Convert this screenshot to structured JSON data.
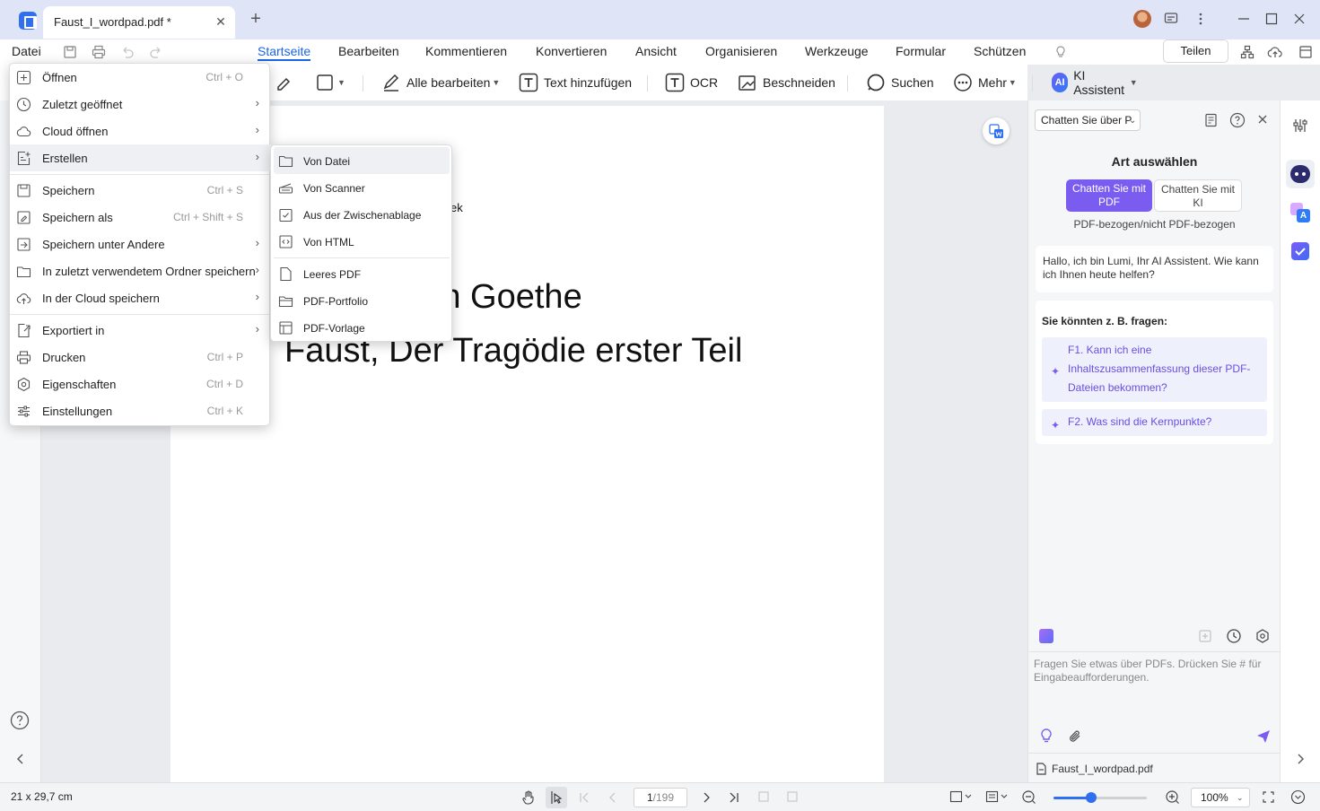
{
  "window": {
    "tab_title": "Faust_I_wordpad.pdf *",
    "close_tab": "✕",
    "new_tab": "+"
  },
  "menubar": {
    "file_label": "Datei",
    "tabs": [
      {
        "label": "Startseite",
        "active": true
      },
      {
        "label": "Bearbeiten"
      },
      {
        "label": "Kommentieren"
      },
      {
        "label": "Konvertieren"
      },
      {
        "label": "Ansicht"
      },
      {
        "label": "Organisieren"
      },
      {
        "label": "Werkzeuge"
      },
      {
        "label": "Formular"
      },
      {
        "label": "Schützen"
      }
    ],
    "share_label": "Teilen"
  },
  "toolbar": {
    "edit_all": "Alle bearbeiten",
    "add_text": "Text hinzufügen",
    "ocr": "OCR",
    "crop": "Beschneiden",
    "search": "Suchen",
    "more": "Mehr",
    "ai_badge": "AI",
    "ai_assistant": "KI Assistent"
  },
  "file_menu": {
    "items": [
      {
        "label": "Öffnen",
        "shortcut": "Ctrl + O",
        "icon": "plus-box-icon"
      },
      {
        "label": "Zuletzt geöffnet",
        "submenu": true,
        "icon": "clock-icon"
      },
      {
        "label": "Cloud öffnen",
        "submenu": true,
        "icon": "cloud-icon"
      },
      {
        "label": "Erstellen",
        "submenu": true,
        "highlighted": true,
        "icon": "create-icon"
      },
      {
        "label": "Speichern",
        "shortcut": "Ctrl + S",
        "icon": "save-icon"
      },
      {
        "label": "Speichern als",
        "shortcut": "Ctrl + Shift + S",
        "icon": "save-as-icon"
      },
      {
        "label": "Speichern unter Andere",
        "submenu": true,
        "icon": "save-other-icon"
      },
      {
        "label": "In zuletzt verwendetem Ordner speichern",
        "submenu": true,
        "icon": "folder-icon"
      },
      {
        "label": "In der Cloud speichern",
        "submenu": true,
        "icon": "cloud-upload-icon"
      },
      {
        "label": "Exportiert in",
        "submenu": true,
        "icon": "export-icon"
      },
      {
        "label": "Drucken",
        "shortcut": "Ctrl + P",
        "icon": "print-icon"
      },
      {
        "label": "Eigenschaften",
        "shortcut": "Ctrl + D",
        "icon": "properties-icon"
      },
      {
        "label": "Einstellungen",
        "shortcut": "Ctrl + K",
        "icon": "settings-sliders-icon"
      }
    ]
  },
  "create_submenu": {
    "items": [
      {
        "label": "Von Datei",
        "highlighted": true,
        "icon": "folder-icon"
      },
      {
        "label": "Von Scanner",
        "icon": "scanner-icon"
      },
      {
        "label": "Aus der Zwischenablage",
        "icon": "clipboard-icon"
      },
      {
        "label": "Von HTML",
        "icon": "html-icon"
      },
      {
        "label": "Leeres PDF",
        "icon": "blank-page-icon"
      },
      {
        "label": "PDF-Portfolio",
        "icon": "portfolio-icon"
      },
      {
        "label": "PDF-Vorlage",
        "icon": "template-icon"
      }
    ]
  },
  "document": {
    "fragment": "ek",
    "line1": "olfgang von Goethe",
    "line2": "Faust, Der Tragödie erster Teil"
  },
  "ai_panel": {
    "dropdown": "Chatten Sie über P",
    "mode_title": "Art auswählen",
    "mode_pdf": "Chatten Sie mit PDF",
    "mode_ki": "Chatten Sie mit KI",
    "mode_sub": "PDF-bezogen/nicht PDF-bezogen",
    "greeting": "Hallo, ich bin Lumi, Ihr AI Assistent. Wie kann ich Ihnen heute helfen?",
    "suggest_title": "Sie könnten z. B. fragen:",
    "suggestions": [
      "F1. Kann ich eine Inhaltszusammenfassung dieser PDF-Dateien bekommen?",
      "F2. Was sind die Kernpunkte?"
    ],
    "input_placeholder": "Fragen Sie etwas über PDFs. Drücken Sie # für Eingabeaufforderungen.",
    "file_name": "Faust_I_wordpad.pdf"
  },
  "statusbar": {
    "page_size": "21 x 29,7 cm",
    "page_current": "1",
    "page_total": "/199",
    "zoom": "100%",
    "zoom_level": 0.4
  },
  "colors": {
    "accent": "#1a66e5",
    "ai_purple": "#7b5cf0"
  }
}
